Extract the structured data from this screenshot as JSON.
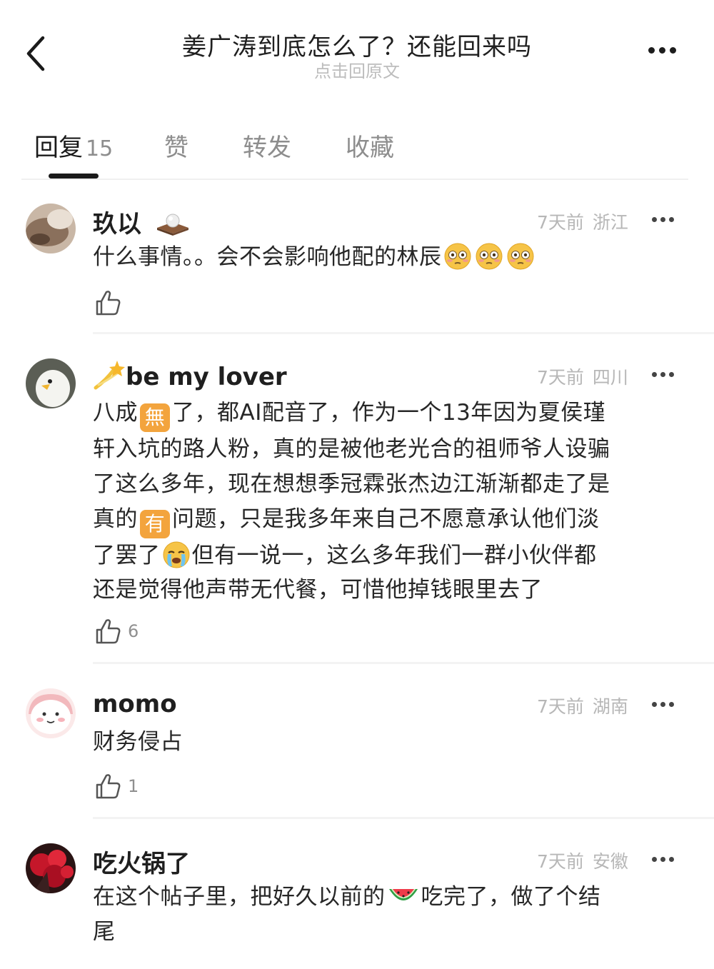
{
  "header": {
    "title": "姜广涛到底怎么了？还能回来吗",
    "subtitle": "点击回原文",
    "back_icon": "back-chevron-icon",
    "more_icon": "more-horizontal-icon"
  },
  "tabs": [
    {
      "label": "回复",
      "count": "15",
      "active": true
    },
    {
      "label": "赞"
    },
    {
      "label": "转发"
    },
    {
      "label": "收藏"
    }
  ],
  "comments": [
    {
      "username": "玖以",
      "time": "7天前",
      "location": "浙江",
      "text_part1": "什么事情。。会不会影响他配的林辰",
      "likes": ""
    },
    {
      "username": "be my lover",
      "time": "7天前",
      "location": "四川",
      "line1_a": "八成",
      "badge1": "無",
      "line1_b": "了，都AI配音了，作为一个13年因为夏侯瑾",
      "line2": "轩入坑的路人粉，真的是被他老光合的祖师爷人设骗",
      "line3": "了这么多年，现在想想季冠霖张杰边江渐渐都走了是",
      "line4_a": "真的",
      "badge2": "有",
      "line4_b": "问题，只是我多年来自己不愿意承认他们淡",
      "line5_a": "了罢了",
      "line5_b": "但有一说一，这么多年我们一群小伙伴都",
      "line6": "还是觉得他声带无代餐，可惜他掉钱眼里去了",
      "likes": "6"
    },
    {
      "username": "momo",
      "time": "7天前",
      "location": "湖南",
      "text": "财务侵占",
      "likes": "1"
    },
    {
      "username": "吃火锅了",
      "time": "7天前",
      "location": "安徽",
      "line1_a": "在这个帖子里，把好久以前的",
      "line1_b": "吃完了，做了个结",
      "line2": "尾"
    }
  ],
  "colors": {
    "accent_badge": "#f3a43d",
    "meta_gray": "#b7b7b7",
    "text_dark": "#272727"
  }
}
